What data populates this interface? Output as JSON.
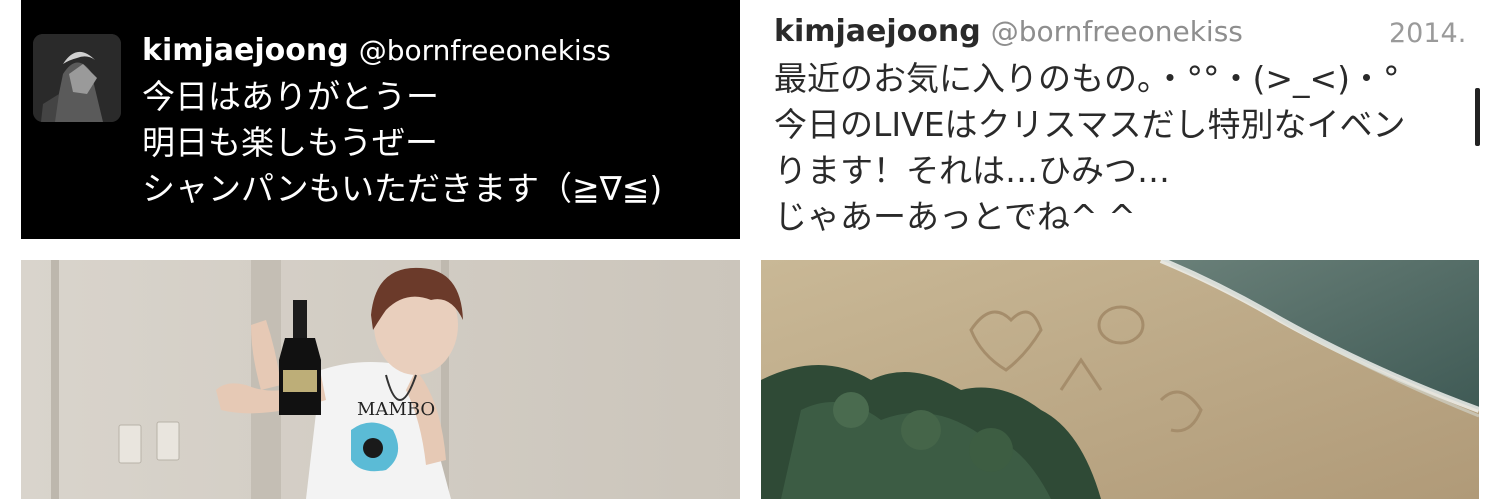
{
  "left_tweet": {
    "name": "kimjaejoong",
    "handle": "@bornfreeonekiss",
    "lines": [
      "今日はありがとうー",
      "明日も楽しもうぜー",
      "シャンパンもいただきます（≧∇≦)"
    ]
  },
  "right_tweet": {
    "name": "kimjaejoong",
    "handle": "@bornfreeonekiss",
    "date": "2014.",
    "lines": [
      "最近のお気に入りのもの。・°°・(>_<)・°",
      "今日のLIVEはクリスマスだし特別なイベン",
      "ります！それは…ひみつ…",
      "じゃあーあっとでね^ ^"
    ]
  },
  "photo_left": {
    "shirt_text": "MAMBO"
  },
  "colors": {
    "left_bg": "#000000",
    "right_bg": "#ffffff",
    "handle_gray": "#8e8e8e"
  }
}
